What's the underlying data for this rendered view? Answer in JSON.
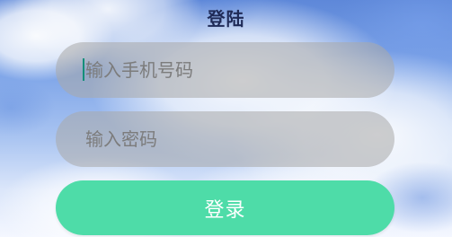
{
  "page": {
    "title": "登陆"
  },
  "form": {
    "phone_placeholder": "输入手机号码",
    "password_placeholder": "输入密码",
    "login_label": "登录"
  },
  "colors": {
    "title": "#1f2a57",
    "field_background": "#aaaaaa8f",
    "login_button": "#4edca8"
  }
}
